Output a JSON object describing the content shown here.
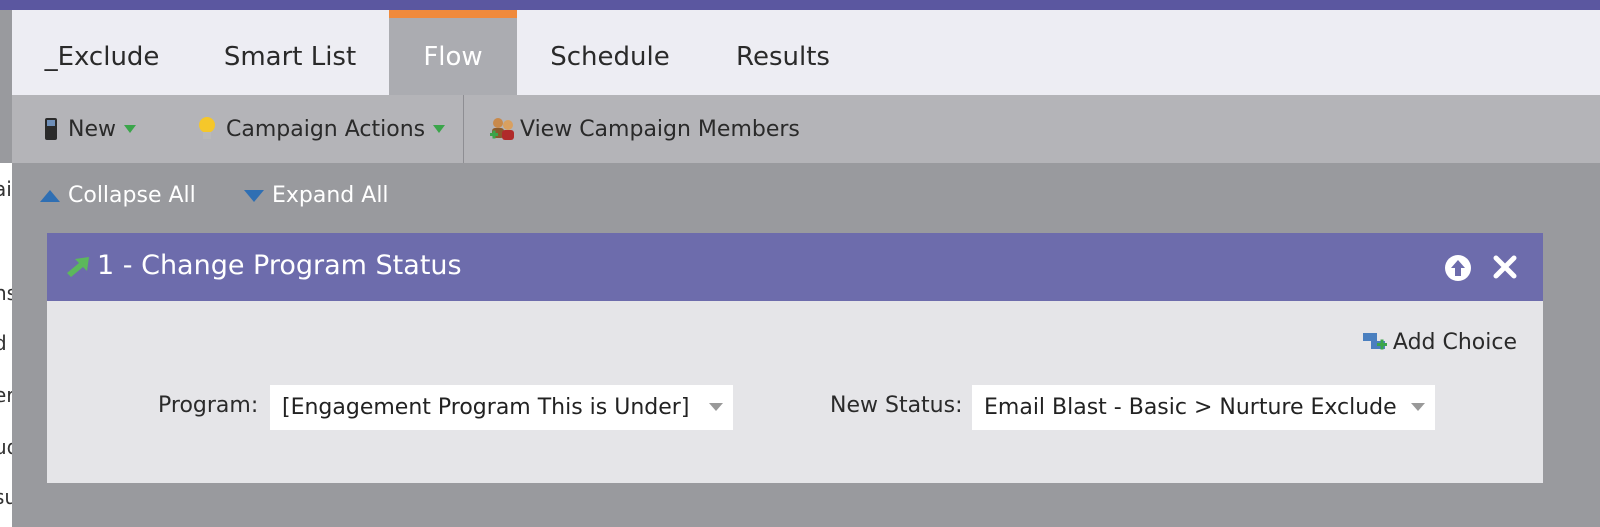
{
  "left_panel": {
    "snippets": [
      "ai",
      "ns",
      "d",
      "er",
      "ud",
      "su"
    ]
  },
  "tabs": [
    {
      "label": "_Exclude"
    },
    {
      "label": "Smart List"
    },
    {
      "label": "Flow"
    },
    {
      "label": "Schedule"
    },
    {
      "label": "Results"
    }
  ],
  "active_tab": "Flow",
  "toolbar": {
    "new_label": "New",
    "campaign_actions_label": "Campaign Actions",
    "view_members_label": "View Campaign Members"
  },
  "controls": {
    "collapse_all_label": "Collapse All",
    "expand_all_label": "Expand All"
  },
  "flow_step": {
    "title": "1 - Change Program Status",
    "add_choice_label": "Add Choice",
    "program_label": "Program:",
    "program_value": "[Engagement Program This is Under]",
    "new_status_label": "New Status:",
    "new_status_value": "Email Blast - Basic > Nurture Exclude"
  },
  "colors": {
    "accent_bar": "#5b57a0",
    "active_tab_border": "#f08a3c",
    "step_header": "#6d6cac"
  },
  "icons": [
    "phone-icon",
    "lightbulb-icon",
    "members-icon",
    "collapse-up-icon",
    "expand-down-icon",
    "green-arrow-icon",
    "move-up-icon",
    "close-icon",
    "add-choice-icon"
  ]
}
